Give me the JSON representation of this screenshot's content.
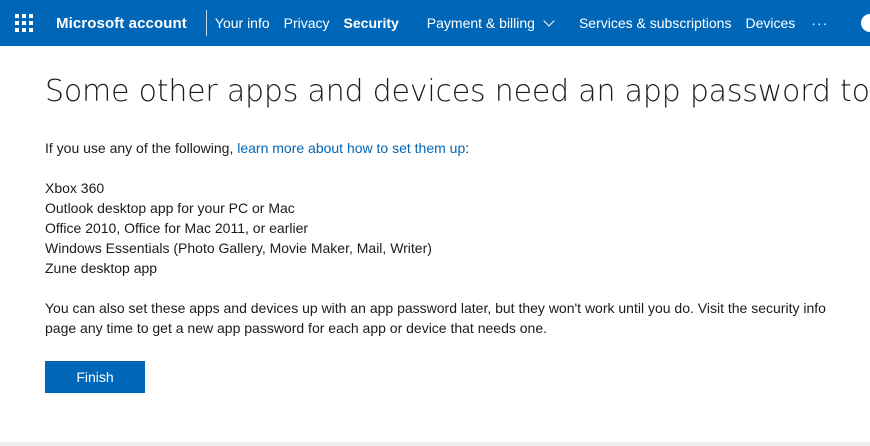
{
  "header": {
    "brand": "Microsoft account",
    "nav": {
      "your_info": "Your info",
      "privacy": "Privacy",
      "security": "Security",
      "payment": "Payment & billing",
      "services": "Services & subscriptions",
      "devices": "Devices",
      "more": "···"
    },
    "accent_color": "#0067b8"
  },
  "main": {
    "title": "Some other apps and devices need an app password too",
    "intro_prefix": "If you use any of the following, ",
    "intro_link": "learn more about how to set them up",
    "intro_suffix": ":",
    "apps": [
      "Xbox 360",
      "Outlook desktop app for your PC or Mac",
      "Office 2010, Office for Mac 2011, or earlier",
      "Windows Essentials (Photo Gallery, Movie Maker, Mail, Writer)",
      "Zune desktop app"
    ],
    "note": "You can also set these apps and devices up with an app password later, but they won't work until you do. Visit the security info page any time to get a new app password for each app or device that needs one.",
    "finish_label": "Finish"
  }
}
